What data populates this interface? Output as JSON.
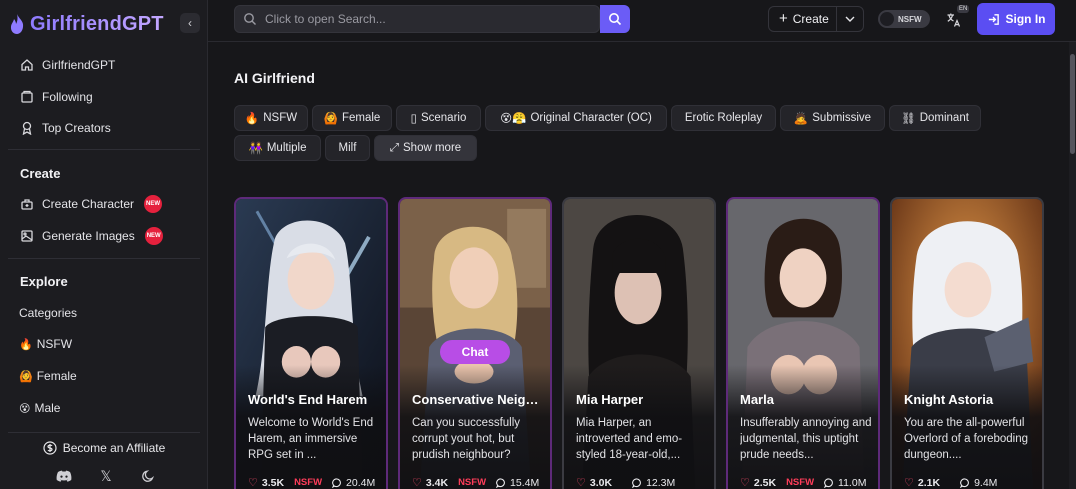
{
  "brand": {
    "name": "GirlfriendGPT"
  },
  "sidebar": {
    "top_items": [
      {
        "label": "GirlfriendGPT",
        "icon": "home-icon"
      },
      {
        "label": "Following",
        "icon": "bookmark-icon"
      },
      {
        "label": "Top Creators",
        "icon": "award-icon"
      }
    ],
    "create_title": "Create",
    "create_items": [
      {
        "label": "Create Character",
        "icon": "character-icon",
        "badge": "NEW"
      },
      {
        "label": "Generate Images",
        "icon": "image-icon",
        "badge": "NEW"
      }
    ],
    "explore_title": "Explore",
    "explore_items": [
      {
        "label": "Categories"
      },
      {
        "label": "NSFW",
        "emoji": "🔥"
      },
      {
        "label": "Female",
        "emoji": "🙆"
      },
      {
        "label": "Male",
        "emoji": "😵"
      }
    ],
    "affiliate_label": "Become an Affiliate"
  },
  "header": {
    "search_placeholder": "Click to open Search...",
    "create_label": "Create",
    "nsfw_label": "NSFW",
    "lang_label": "EN",
    "signin_label": "Sign In"
  },
  "main": {
    "title": "AI Girlfriend",
    "chips": [
      {
        "label": "NSFW",
        "emoji": "🔥"
      },
      {
        "label": "Female",
        "emoji": "🙆"
      },
      {
        "label": "Scenario",
        "emoji": "▯"
      },
      {
        "label": "Original Character (OC)",
        "emoji": "😵😤"
      },
      {
        "label": "Erotic Roleplay",
        "emoji": ""
      },
      {
        "label": "Submissive",
        "emoji": "🙇"
      },
      {
        "label": "Dominant",
        "emoji": "⛓"
      },
      {
        "label": "Multiple",
        "emoji": "👭"
      },
      {
        "label": "Milf",
        "emoji": ""
      },
      {
        "label": "Show more",
        "emoji": "⤢"
      }
    ],
    "chat_label": "Chat",
    "cards": [
      {
        "name": "World's End Harem",
        "description": "Welcome to World's End Harem, an immersive RPG set in ...",
        "likes": "3.5K",
        "nsfw": "NSFW",
        "chats": "20.4M"
      },
      {
        "name": "Conservative Neighbour",
        "description": "Can you successfully corrupt yout hot, but prudish neighbour?",
        "likes": "3.4K",
        "nsfw": "NSFW",
        "chats": "15.4M"
      },
      {
        "name": "Mia Harper",
        "description": "Mia Harper, an introverted and emo-styled 18-year-old,...",
        "likes": "3.0K",
        "nsfw": "",
        "chats": "12.3M"
      },
      {
        "name": "Marla",
        "description": "Insufferably annoying and judgmental, this uptight prude needs...",
        "likes": "2.5K",
        "nsfw": "NSFW",
        "chats": "11.0M"
      },
      {
        "name": "Knight Astoria",
        "description": "You are the all-powerful Overlord of a foreboding dungeon....",
        "likes": "2.1K",
        "nsfw": "",
        "chats": "9.4M"
      }
    ]
  },
  "colors": {
    "accent": "#6b5cf6",
    "brand": "#a18cff",
    "nsfw": "#ff3d5a",
    "chat": "#b84de6"
  }
}
